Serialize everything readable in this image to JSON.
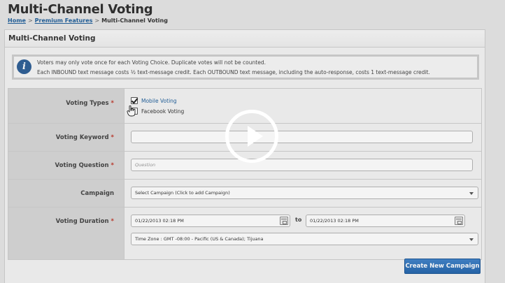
{
  "page": {
    "title": "Multi-Channel Voting"
  },
  "breadcrumb": {
    "home": "Home",
    "separator": ">",
    "premium": "Premium Features",
    "current": "Multi-Channel Voting"
  },
  "panel": {
    "title": "Multi-Channel Voting"
  },
  "info": {
    "icon": "info-icon",
    "line1": "Voters may only vote once for each Voting Choice. Duplicate votes will not be counted.",
    "line2": "Each INBOUND text message costs ½ text-message credit. Each OUTBOUND text message, including the auto-response, costs 1 text-message credit."
  },
  "form": {
    "required_mark": "*",
    "voting_types": {
      "label": "Voting Types",
      "options": [
        {
          "label": "Mobile Voting",
          "checked": true
        },
        {
          "label": "Facebook Voting",
          "checked": false
        }
      ]
    },
    "voting_keyword": {
      "label": "Voting Keyword",
      "value": ""
    },
    "voting_question": {
      "label": "Voting Question",
      "placeholder": "Question"
    },
    "campaign": {
      "label": "Campaign",
      "selected": "Select Campaign (Click to add Campaign)"
    },
    "voting_duration": {
      "label": "Voting Duration",
      "start": "01/22/2013 02:18 PM",
      "to_label": "to",
      "end": "01/22/2013 02:18 PM",
      "timezone": "Time Zone : GMT -08:00 - Pacific (US & Canada); Tijuana"
    }
  },
  "actions": {
    "create_campaign": "Create New Campaign"
  },
  "video": {
    "play_icon": "play-icon"
  },
  "colors": {
    "accent": "#2466ad",
    "link": "#1f5f9b",
    "required": "#c0392b",
    "info_icon": "#2e5f96"
  }
}
